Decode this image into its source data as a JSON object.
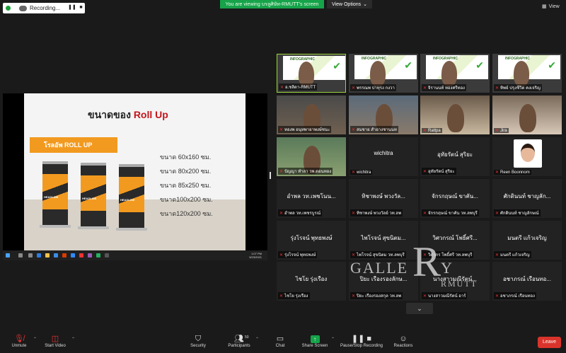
{
  "topbar": {
    "recording_label": "Recording...",
    "pause_icon": "pause-icon",
    "stop_icon": "stop-icon",
    "viewing_banner": "You are viewing บรลูศิษัท-RMUTT's screen",
    "view_options_label": "View Options",
    "view_label": "View"
  },
  "slide": {
    "title_prefix": "ขนาดของ ",
    "title_highlight": "Roll Up",
    "title_highlight_color": "#c4161c",
    "banner": "โรลอัพ ROLL UP",
    "banner_color": "#f29a1f",
    "standee_label": "HEADLINE",
    "sizes": [
      "ขนาด 60x160 ซม.",
      "ขนาด 80x200 ซม.",
      "ขนาด 85x250 ซม.",
      "ขนาด100x200 ซม.",
      "ขนาด120x200 ซม."
    ]
  },
  "taskbar": {
    "time": "1:07 PM",
    "date": "9/23/2021"
  },
  "poster": {
    "title": "INFOGRAPHIC"
  },
  "participants": [
    {
      "name": "อ.ชลิดา-RMUTT",
      "kind": "poster-active"
    },
    {
      "name": "พรรณพ ปาทุรง กงวา",
      "kind": "poster"
    },
    {
      "name": "จิรานนท์ ทองศรีทอง",
      "kind": "poster"
    },
    {
      "name": "ทิพย์ ปรุงชีวิต คงเจริญ",
      "kind": "poster"
    },
    {
      "name": "ทองพ อนุทพายาพงษ์ชนะ",
      "kind": "video"
    },
    {
      "name": "สมชาย สำอางชานนท",
      "kind": "video"
    },
    {
      "name": "Rattpa",
      "kind": "video"
    },
    {
      "name": "Jira",
      "kind": "video"
    },
    {
      "name": "ปัญญา ทำลา วพ.ดอนทอง",
      "kind": "video"
    },
    {
      "name": "wichitra",
      "big": "wichitra",
      "kind": "name"
    },
    {
      "name": "อุทัยรัตน์ สุริยะ",
      "big": "อุทัยรัตน์ สุริยะ",
      "kind": "name"
    },
    {
      "name": "Reen Boonnom",
      "kind": "photo"
    },
    {
      "name": "อำพล วท.เพชรบูรณ์",
      "big": "อำพล วท.เพชโนน...",
      "kind": "name"
    },
    {
      "name": "ทิชาพงษ์ พวงวัลย์ วท.ลพ",
      "big": "ทิชาพงษ์ พวงวัล...",
      "kind": "name"
    },
    {
      "name": "จักรกฤษณ์ ขาคัน วท.ลพบุรี",
      "big": "จักรกฤษณ์ ขาคัน...",
      "kind": "name"
    },
    {
      "name": "ศักดินนท์ ชาญลักษณ์",
      "big": "ศักดินนท์ ชาญลัก...",
      "kind": "name"
    },
    {
      "name": "รุ่งโรจน์ พุทธพงษ์",
      "big": "รุ่งโรจน์ พุทธพงษ์",
      "kind": "name"
    },
    {
      "name": "ไพโรจน์ สุขนิตม วท.ลพบุรี",
      "big": "ไพโรจน์ สุขนิตม...",
      "kind": "name"
    },
    {
      "name": "วิศวกร โพธิ์ศรี วท.ลพบุรี",
      "big": "วิศวกรณ์ โพธิ์ศรี...",
      "kind": "name"
    },
    {
      "name": "มนตรี แก้วเจริญ",
      "big": "มนตรี แก้วเจริญ",
      "kind": "name"
    },
    {
      "name": "ไชโย รุ่งเรือง",
      "big": "ไชโย รุ่งเรือง",
      "kind": "name"
    },
    {
      "name": "ปิยะ เรืองรองสกุล วท.ลพ",
      "big": "ปิยะ เรืองรองลักษ...",
      "kind": "name"
    },
    {
      "name": "นางสาวมณีรัตน์ อาร์",
      "big": "นางสาวมณีรัตน์...",
      "kind": "name"
    },
    {
      "name": "อชาภรณ์ เรือนทอง",
      "big": "อชาภรณ์ เรือนทอ...",
      "kind": "name"
    }
  ],
  "watermark": {
    "gallery": "GALLE",
    "r": "R",
    "y": "Y",
    "rmutt": "RMUTT"
  },
  "toolbar": {
    "unmute": "Unmute",
    "start_video": "Start Video",
    "security": "Security",
    "participants": "Participants",
    "participants_count": "50",
    "chat": "Chat",
    "share_screen": "Share Screen",
    "pause_recording": "Pause/Stop Recording",
    "reactions": "Reactions",
    "leave": "Leave",
    "leave_color": "#d9342b"
  }
}
